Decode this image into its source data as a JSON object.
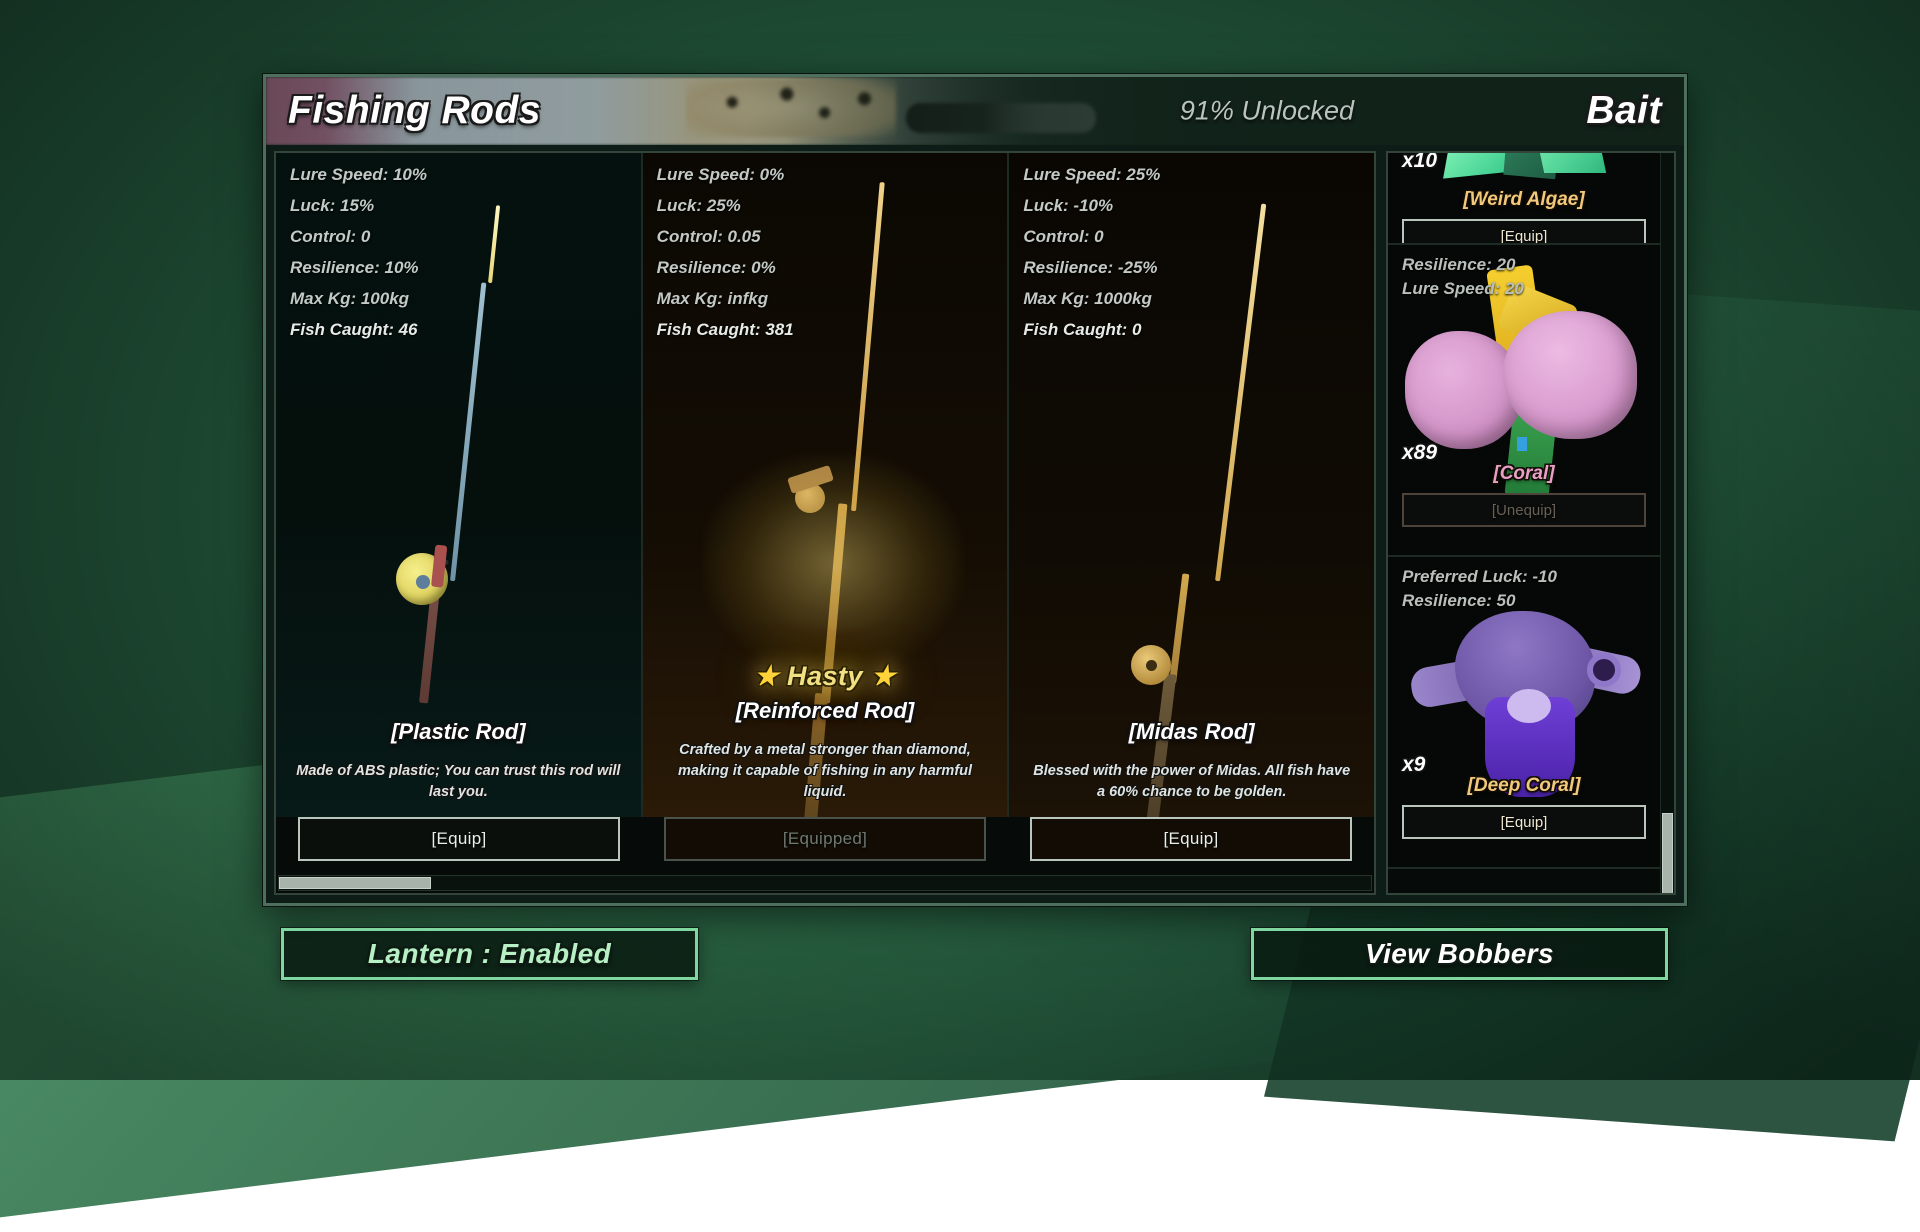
{
  "header": {
    "title_left": "Fishing Rods",
    "unlocked": "91% Unlocked",
    "title_right": "Bait"
  },
  "rods": [
    {
      "stats": [
        "Lure Speed: 10%",
        "Luck: 15%",
        "Control: 0",
        "Resilience: 10%",
        "Max Kg: 100kg"
      ],
      "fish_caught": "Fish Caught: 46",
      "badge": "",
      "name": "[Plastic Rod]",
      "description": "Made of ABS plastic; You can trust this rod will last you.",
      "button": "[Equip]",
      "equipped": false
    },
    {
      "stats": [
        "Lure Speed: 0%",
        "Luck: 25%",
        "Control: 0.05",
        "Resilience: 0%",
        "Max Kg: infkg"
      ],
      "fish_caught": "Fish Caught: 381",
      "badge": "Hasty",
      "name": "[Reinforced Rod]",
      "description": "Crafted by a metal stronger than diamond, making it capable of fishing in any harmful liquid.",
      "button": "[Equipped]",
      "equipped": true
    },
    {
      "stats": [
        "Lure Speed: 25%",
        "Luck: -10%",
        "Control: 0",
        "Resilience: -25%",
        "Max Kg: 1000kg"
      ],
      "fish_caught": "Fish Caught: 0",
      "badge": "",
      "name": "[Midas Rod]",
      "description": "Blessed with the power of Midas. All fish have a 60% chance to be golden.",
      "button": "[Equip]",
      "equipped": false
    }
  ],
  "bait": [
    {
      "stats": [],
      "count": "x10",
      "name": "[Weird Algae]",
      "name_color": "#f2c97a",
      "button": "[Equip]",
      "equipped": false
    },
    {
      "stats": [
        "Resilience: 20",
        "Lure Speed: 20"
      ],
      "count": "x89",
      "name": "[Coral]",
      "name_color": "#e9a0c8",
      "button": "[Unequip]",
      "equipped": true
    },
    {
      "stats": [
        "Preferred Luck: -10",
        "Resilience: 50"
      ],
      "count": "x9",
      "name": "[Deep Coral]",
      "name_color": "#f2c97a",
      "button": "[Equip]",
      "equipped": false
    }
  ],
  "bottom": {
    "lantern": "Lantern : Enabled",
    "bobbers": "View Bobbers"
  },
  "colors": {
    "accent_green": "#7fd7a0",
    "hasty_gold": "#f2e085",
    "coral_pink": "#e9a0c8",
    "bait_gold": "#f2c97a"
  }
}
